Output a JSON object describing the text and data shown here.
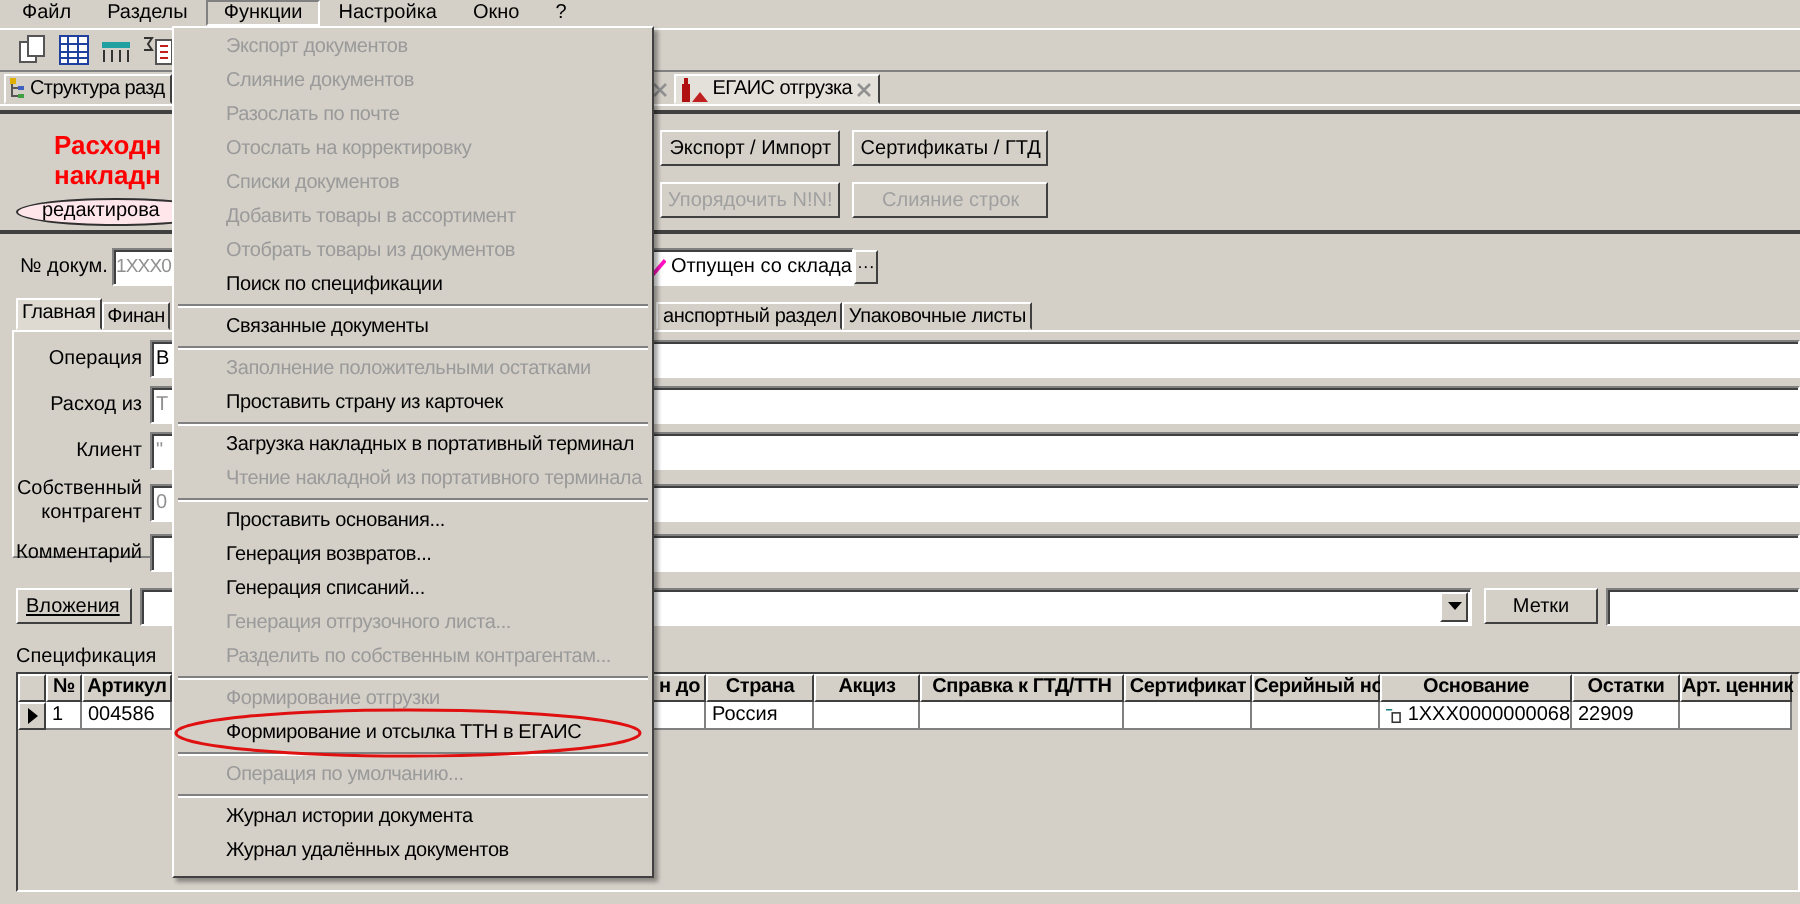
{
  "menu_bar": [
    {
      "label": "Файл",
      "selected": false
    },
    {
      "label": "Разделы",
      "selected": false
    },
    {
      "label": "Функции",
      "selected": true
    },
    {
      "label": "Настройка",
      "selected": false
    },
    {
      "label": "Окно",
      "selected": false
    },
    {
      "label": "?",
      "selected": false
    }
  ],
  "document_tabs": [
    {
      "label": "Структура разд",
      "kind": "structure",
      "selected": false
    },
    {
      "label": "ЕГАИС отгрузка",
      "kind": "egais",
      "selected": true
    }
  ],
  "header": {
    "title_lines": [
      "Расходн",
      "накладн"
    ],
    "status_badge": "редактирова",
    "buttons": [
      {
        "label": "Экспорт / Импорт",
        "disabled": false
      },
      {
        "label": "Сертификаты / ГТД",
        "disabled": false
      },
      {
        "label": "Упорядочить N!N!",
        "disabled": true
      },
      {
        "label": "Слияние строк",
        "disabled": true
      }
    ]
  },
  "document_number": {
    "label": "№ докум.",
    "value": "1XXX0"
  },
  "document_status": {
    "value": "Отпущен со склада",
    "checked": true,
    "button": "···"
  },
  "form_tabs": [
    {
      "label": "Главная",
      "selected": true
    },
    {
      "label": "Финан",
      "selected": false
    },
    {
      "label": "анспортный раздел",
      "selected": false
    },
    {
      "label": "Упаковочные листы",
      "selected": false
    }
  ],
  "form_fields": [
    {
      "label": "Операция",
      "value": "В",
      "readonly": false
    },
    {
      "label": "Расход из",
      "value": "Т",
      "readonly": true
    },
    {
      "label": "Клиент",
      "value": "\"",
      "readonly": true
    },
    {
      "label": "Собственный контрагент",
      "value": "0",
      "readonly": true
    },
    {
      "label": "Комментарий",
      "readonly": false
    }
  ],
  "attachments": {
    "button": "Вложения",
    "tags_button": "Метки"
  },
  "specification": {
    "title": "Спецификация",
    "columns": [
      "№",
      "Артикул",
      "н до",
      "Страна",
      "Акциз",
      "Справка к ГТД/ТТН",
      "Сертификат",
      "Серийный но",
      "Основание",
      "Остатки",
      "Арт. ценник"
    ],
    "rows": [
      {
        "current": true,
        "cells": [
          {
            "text": "1"
          },
          {
            "text": "004586"
          },
          null,
          {
            "text": "Россия"
          },
          null,
          null,
          null,
          null,
          {
            "text": "1XXX0000000068",
            "linked": true
          },
          {
            "text": "22909"
          },
          null
        ]
      }
    ]
  },
  "functions_menu": [
    {
      "label": "Экспорт документов",
      "disabled": true
    },
    {
      "label": "Слияние документов",
      "disabled": true
    },
    {
      "label": "Разослать по почте",
      "disabled": true
    },
    {
      "label": "Отослать на корректировку",
      "disabled": true
    },
    {
      "label": "Списки документов",
      "disabled": true
    },
    {
      "label": "Добавить товары в ассортимент",
      "disabled": true
    },
    {
      "label": "Отобрать товары из документов",
      "disabled": true
    },
    {
      "label": "Поиск по спецификации",
      "disabled": false,
      "separator_after": true
    },
    {
      "label": "Связанные документы",
      "disabled": false,
      "separator_after": true
    },
    {
      "label": "Заполнение положительными остатками",
      "disabled": true
    },
    {
      "label": "Проставить страну из карточек",
      "disabled": false,
      "separator_after": true
    },
    {
      "label": "Загрузка накладных в портативный терминал",
      "disabled": false
    },
    {
      "label": "Чтение накладной из портативного терминала",
      "disabled": true,
      "separator_after": true
    },
    {
      "label": "Проставить основания...",
      "disabled": false
    },
    {
      "label": "Генерация возвратов...",
      "disabled": false
    },
    {
      "label": "Генерация списаний...",
      "disabled": false
    },
    {
      "label": "Генерация отгрузочного листа...",
      "disabled": true
    },
    {
      "label": "Разделить по собственным контрагентам...",
      "disabled": true,
      "separator_after": true
    },
    {
      "label": "Формирование отгрузки",
      "disabled": true
    },
    {
      "label": "Формирование и отсылка ТТН в ЕГАИС",
      "disabled": false,
      "highlighted": true,
      "separator_after": true
    },
    {
      "label": "Операция по умолчанию...",
      "disabled": true,
      "separator_after": true
    },
    {
      "label": "Журнал истории документа",
      "disabled": false
    },
    {
      "label": "Журнал удалённых документов",
      "disabled": false
    }
  ]
}
